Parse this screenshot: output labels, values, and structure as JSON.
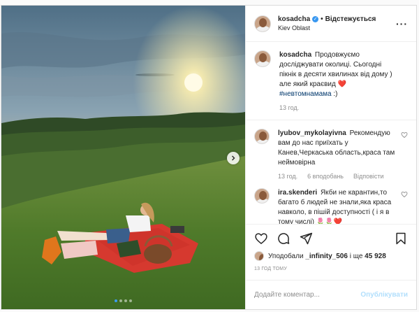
{
  "post": {
    "author": {
      "username": "kosadcha",
      "follow_state": "Відстежується",
      "location": "Kiev Oblast"
    },
    "caption": {
      "username": "kosadcha",
      "text": "Продовжуємо досліджувати околиці. Сьогодні пікнік в десяти хвилинах від дому ) але який краєвид",
      "heart": "❤️",
      "hashtag": "#невтомнамама",
      "trailing": ":)",
      "time": "13 год."
    },
    "comments": [
      {
        "username": "lyubov_mykolayivna",
        "text": "Рекомендую вам до нас приїхать у Канев,Черкаська область,краса там неймовірна",
        "time": "13 год.",
        "likes": "6 вподобань",
        "reply": "Відповісти"
      },
      {
        "username": "ira.skenderi",
        "text": "Якби не карантин,то багато б людей не знали,яка краса навколо, в пішій доступності ( і я в тому числі)",
        "emoji": "🌷🌷❤️"
      }
    ],
    "likes_text": {
      "prefix": "Уподобали",
      "user": "_infinity_506",
      "middle": "і ще",
      "count": "45 928"
    },
    "timestamp": "13 ГОД ТОМУ",
    "add_comment": {
      "placeholder": "Додайте коментар...",
      "post_label": "Опублікувати"
    },
    "carousel": {
      "total": 4,
      "active": 1
    },
    "icons": {
      "more": "more-options-icon",
      "like": "heart-icon",
      "comment": "comment-icon",
      "share": "share-icon",
      "save": "bookmark-icon",
      "next": "chevron-right-icon"
    },
    "colors": {
      "verified": "#3897f0",
      "heart": "#ed4956",
      "hashtag": "#00376b",
      "post_disabled": "#b2dffc",
      "carousel_active": "#3b9cf0"
    }
  }
}
